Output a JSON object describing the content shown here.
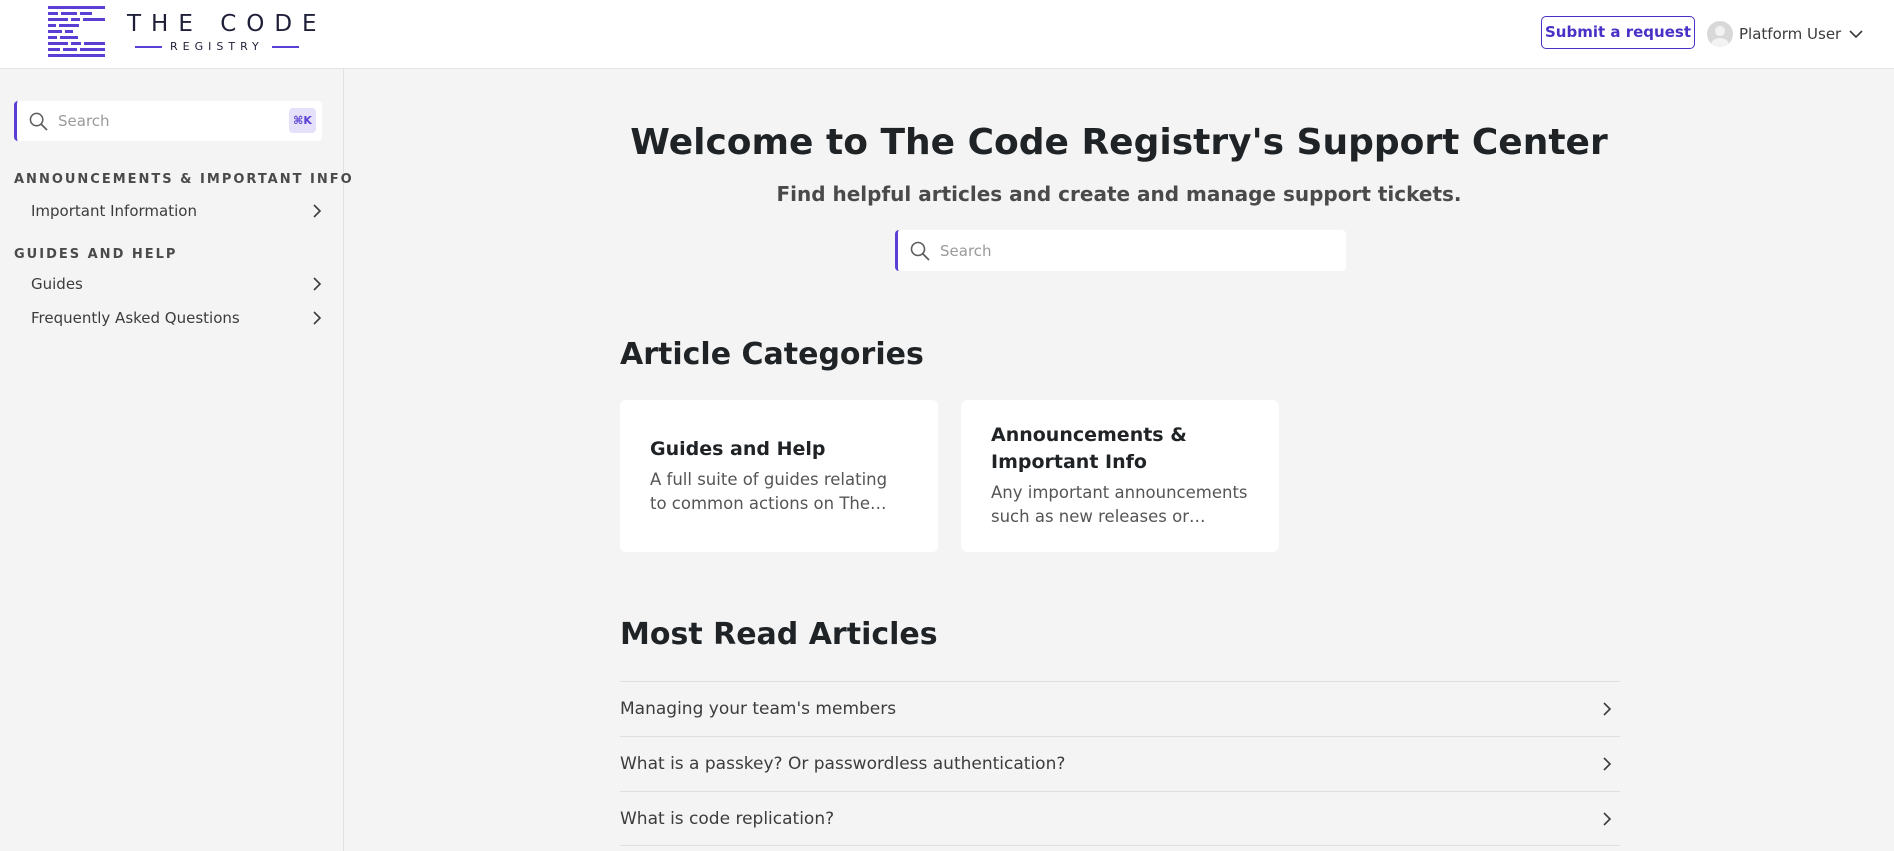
{
  "brand": {
    "title": "THE CODE",
    "subtitle": "REGISTRY",
    "accent_color": "#5b3fd4"
  },
  "header": {
    "submit_label": "Submit a request",
    "user_name": "Platform User"
  },
  "sidebar": {
    "search_placeholder": "Search",
    "shortcut": "⌘K",
    "sections": [
      {
        "title": "ANNOUNCEMENTS & IMPORTANT INFO",
        "items": [
          {
            "label": "Important Information"
          }
        ]
      },
      {
        "title": "GUIDES AND HELP",
        "items": [
          {
            "label": "Guides"
          },
          {
            "label": "Frequently Asked Questions"
          }
        ]
      }
    ]
  },
  "hero": {
    "title": "Welcome to The Code Registry's Support Center",
    "subtitle": "Find helpful articles and create and manage support tickets.",
    "search_placeholder": "Search"
  },
  "categories": {
    "title": "Article Categories",
    "cards": [
      {
        "title": "Guides and Help",
        "description": "A full suite of guides relating to common actions on The Code Registry platform."
      },
      {
        "title": "Announcements & Important Info",
        "description": "Any important announcements such as new releases or updates to the platform."
      }
    ]
  },
  "most_read": {
    "title": "Most Read Articles",
    "articles": [
      {
        "label": "Managing your team's members"
      },
      {
        "label": "What is a passkey? Or passwordless authentication?"
      },
      {
        "label": "What is code replication?"
      }
    ]
  }
}
